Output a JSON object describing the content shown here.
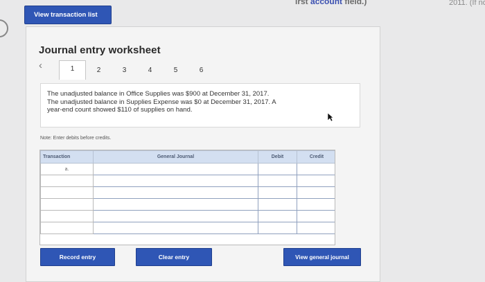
{
  "header": {
    "cut_text_left": "irst ",
    "cut_text_blue": "account",
    "cut_text_right": " field.)",
    "cut_text_far": "2011. (If no"
  },
  "top_button": {
    "label": "View transaction list"
  },
  "worksheet": {
    "title": "Journal entry worksheet",
    "prev_icon": "‹",
    "next_icon": "›",
    "tabs": [
      "1",
      "2",
      "3",
      "4",
      "5",
      "6"
    ],
    "active_tab": "1",
    "info_lines": [
      "The unadjusted balance in Office Supplies was $900 at December 31, 2017.",
      "The unadjusted balance in Supplies Expense was $0 at December 31, 2017. A",
      "year-end count showed $110 of supplies on hand."
    ],
    "note": "Note: Enter debits before credits."
  },
  "table": {
    "headers": {
      "transaction": "Transaction",
      "general_journal": "General Journal",
      "debit": "Debit",
      "credit": "Credit"
    },
    "rows": [
      {
        "transaction": "a."
      },
      {
        "transaction": ""
      },
      {
        "transaction": ""
      },
      {
        "transaction": ""
      },
      {
        "transaction": ""
      },
      {
        "transaction": ""
      }
    ]
  },
  "buttons": {
    "record": "Record entry",
    "clear": "Clear entry",
    "general": "View general journal"
  },
  "colors": {
    "button_blue": "#2f56b5",
    "header_blue": "#d3dff1",
    "background": "#e9e9ea"
  },
  "icons": {
    "cursor": "mouse-pointer-icon"
  }
}
